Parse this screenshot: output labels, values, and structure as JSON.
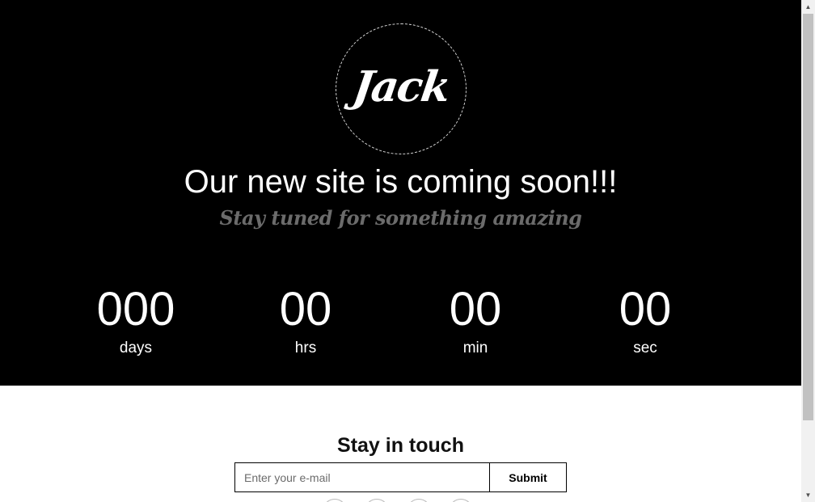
{
  "logo": {
    "text": "Jack"
  },
  "hero": {
    "headline": "Our new site is coming soon!!!",
    "tagline": "Stay tuned for something amazing"
  },
  "countdown": {
    "days": {
      "value": "000",
      "label": "days"
    },
    "hrs": {
      "value": "00",
      "label": "hrs"
    },
    "min": {
      "value": "00",
      "label": "min"
    },
    "sec": {
      "value": "00",
      "label": "sec"
    }
  },
  "subscribe": {
    "title": "Stay in touch",
    "email_placeholder": "Enter your e-mail",
    "submit_label": "Submit"
  },
  "colors": {
    "hero_bg": "#000000",
    "tagline": "#6b6b6b"
  },
  "icons": {
    "scroll_up": "arrow-up-icon",
    "scroll_down": "arrow-down-icon"
  }
}
